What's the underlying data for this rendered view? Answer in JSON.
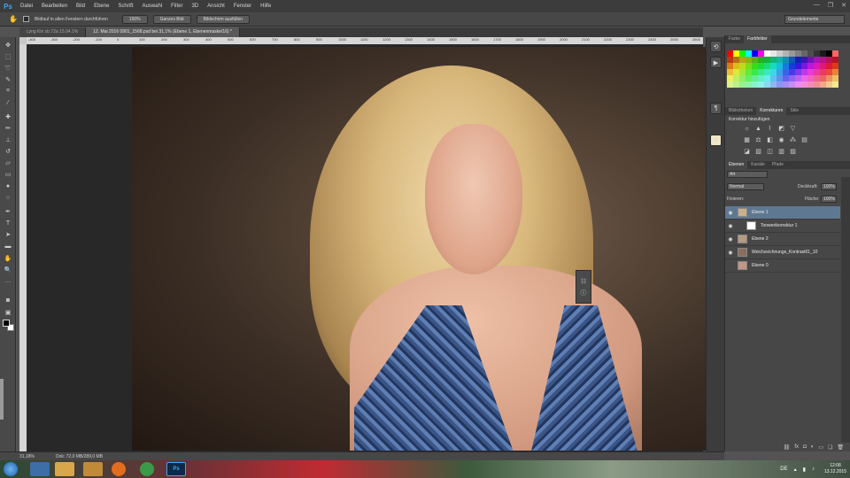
{
  "app": {
    "logo": "Ps"
  },
  "menu": [
    "Datei",
    "Bearbeiten",
    "Bild",
    "Ebene",
    "Schrift",
    "Auswahl",
    "Filter",
    "3D",
    "Ansicht",
    "Fenster",
    "Hilfe"
  ],
  "window_controls": [
    "—",
    "❐",
    "✕"
  ],
  "options": {
    "checkbox_label": "Bildlauf in allen Fenstern durchführen",
    "btn_100": "100%",
    "btn_ganzes_bild": "Ganzes Bild",
    "btn_bildschirm": "Bildschirm ausfüllen",
    "workspace": "Grundelemente"
  },
  "tabs": [
    {
      "label": "Lyng Kin sb.72a 15.04.1%",
      "active": false
    },
    {
      "label": "12. Mai 2016 0901_1568.psd bei 31,1% (Ebene 1, Ebenenmaske/16) *",
      "active": true
    }
  ],
  "ruler_labels": [
    "-400",
    "-300",
    "-200",
    "-100",
    "0",
    "100",
    "200",
    "300",
    "400",
    "500",
    "600",
    "700",
    "800",
    "900",
    "1000",
    "1100",
    "1200",
    "1300",
    "1400",
    "1500",
    "1600",
    "1700",
    "1800",
    "1900",
    "2000",
    "2100",
    "2200",
    "2300",
    "2400",
    "2500",
    "2600"
  ],
  "status": {
    "zoom": "31,18%",
    "doc": "Dok: 72,0 MB/289,0 MB"
  },
  "panels": {
    "swatches_tabs": [
      "Farbe",
      "Farbfelder"
    ],
    "adjust_tabs": [
      "Bibliotheken",
      "Korrekturen",
      "Stile"
    ],
    "adjust_title": "Korrektur hinzufügen",
    "layers_tabs": [
      "Ebenen",
      "Kanäle",
      "Pfade"
    ],
    "kind": "Art",
    "blend_mode": "Normal",
    "opacity_label": "Deckkraft:",
    "opacity": "100%",
    "lock_label": "Fixieren:",
    "fill_label": "Fläche:",
    "fill": "100%",
    "layers": [
      {
        "name": "Ebene 1",
        "selected": true,
        "visible": true,
        "thumb": "#c9b08a"
      },
      {
        "name": "Tonwertkorrektur 1",
        "selected": false,
        "visible": true,
        "thumb": "#ffffff"
      },
      {
        "name": "Ebene 2",
        "selected": false,
        "visible": true,
        "thumb": "#b79a80"
      },
      {
        "name": "Weichzeichnungs_Kontrast01_10",
        "selected": false,
        "visible": true,
        "thumb": "#8a6e5c"
      },
      {
        "name": "Ebene 0",
        "selected": false,
        "visible": false,
        "thumb": "#c49484"
      }
    ]
  },
  "taskbar": {
    "items": [
      "",
      "",
      "",
      "",
      "",
      "Ps"
    ],
    "tray_lang": "DE",
    "time": "12:08",
    "date": "13.12.2015"
  },
  "colors": {
    "ps_blue": "#31a8ff",
    "selected_layer": "#5f7891",
    "swatches": [
      "#ff0000",
      "#ffff00",
      "#00ff00",
      "#00ffff",
      "#0000ff",
      "#ff00ff",
      "#ffffff",
      "#e6e6e6",
      "#cccccc",
      "#b3b3b3",
      "#999999",
      "#808080",
      "#666666",
      "#4d4d4d",
      "#333333",
      "#1a1a1a",
      "#000000",
      "#ff6666"
    ]
  }
}
